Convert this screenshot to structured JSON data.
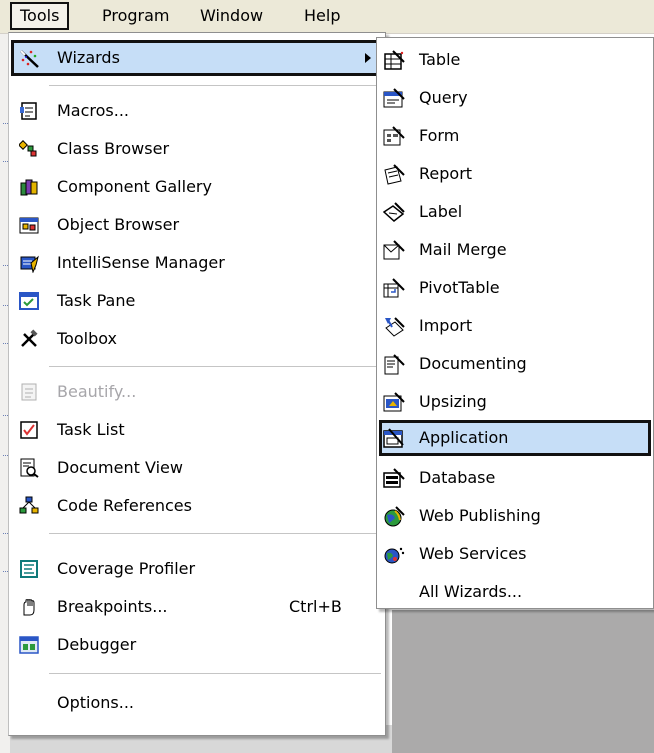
{
  "menubar": {
    "items": [
      {
        "label": "Tools"
      },
      {
        "label": "Program"
      },
      {
        "label": "Window"
      },
      {
        "label": "Help"
      }
    ]
  },
  "tools_menu": {
    "items": [
      {
        "label": "Wizards",
        "icon": "wand-icon"
      },
      {
        "label": "Macros...",
        "icon": "macros-icon"
      },
      {
        "label": "Class Browser",
        "icon": "class-browser-icon"
      },
      {
        "label": "Component Gallery",
        "icon": "component-gallery-icon"
      },
      {
        "label": "Object Browser",
        "icon": "object-browser-icon"
      },
      {
        "label": "IntelliSense Manager",
        "icon": "intellisense-icon"
      },
      {
        "label": "Task Pane",
        "icon": "task-pane-icon"
      },
      {
        "label": "Toolbox",
        "icon": "toolbox-icon"
      },
      {
        "label": "Beautify...",
        "icon": "beautify-icon"
      },
      {
        "label": "Task List",
        "icon": "task-list-icon"
      },
      {
        "label": "Document View",
        "icon": "document-view-icon"
      },
      {
        "label": "Code References",
        "icon": "code-references-icon"
      },
      {
        "label": "Coverage Profiler",
        "icon": "coverage-profiler-icon"
      },
      {
        "label": "Breakpoints...",
        "icon": "breakpoints-icon",
        "shortcut": "Ctrl+B"
      },
      {
        "label": "Debugger",
        "icon": "debugger-icon"
      },
      {
        "label": "Options...",
        "icon": ""
      }
    ]
  },
  "wizards_menu": {
    "items": [
      {
        "label": "Table",
        "icon": "table-wizard-icon"
      },
      {
        "label": "Query",
        "icon": "query-wizard-icon"
      },
      {
        "label": "Form",
        "icon": "form-wizard-icon"
      },
      {
        "label": "Report",
        "icon": "report-wizard-icon"
      },
      {
        "label": "Label",
        "icon": "label-wizard-icon"
      },
      {
        "label": "Mail Merge",
        "icon": "mail-merge-icon"
      },
      {
        "label": "PivotTable",
        "icon": "pivottable-icon"
      },
      {
        "label": "Import",
        "icon": "import-icon"
      },
      {
        "label": "Documenting",
        "icon": "documenting-icon"
      },
      {
        "label": "Upsizing",
        "icon": "upsizing-icon"
      },
      {
        "label": "Application",
        "icon": "application-wizard-icon"
      },
      {
        "label": "Database",
        "icon": "database-wizard-icon"
      },
      {
        "label": "Web Publishing",
        "icon": "web-publishing-icon"
      },
      {
        "label": "Web Services",
        "icon": "web-services-icon"
      },
      {
        "label": "All Wizards...",
        "icon": ""
      }
    ]
  },
  "colors": {
    "highlight": "#c6def7",
    "menubar": "#ece9d8",
    "disabled_text": "#a7a6aa",
    "desktop_gray": "#abaaaa"
  }
}
